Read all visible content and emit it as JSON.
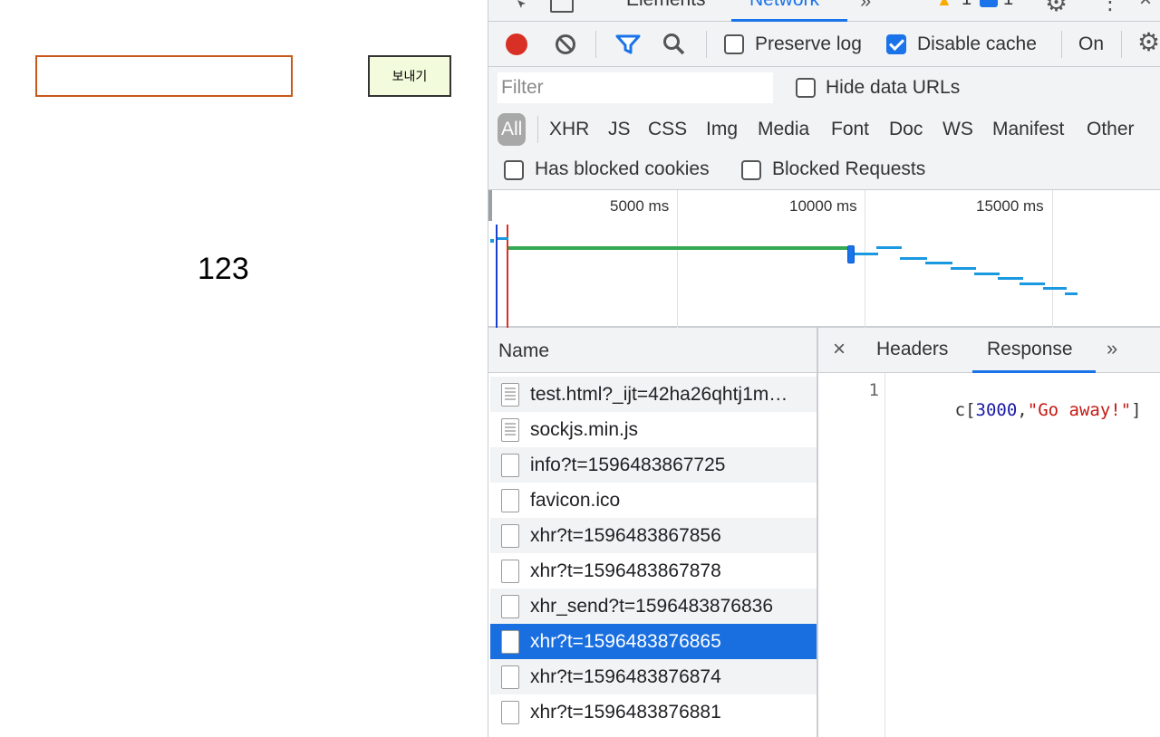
{
  "page": {
    "input_value": "",
    "send_label": "보내기",
    "value_text": "123"
  },
  "devtools": {
    "tabs": [
      "Elements",
      "Network"
    ],
    "badges": {
      "warnings": "1",
      "messages": "1"
    },
    "toolbar": {
      "preserve_log": {
        "label": "Preserve log",
        "checked": false
      },
      "disable_cache": {
        "label": "Disable cache",
        "checked": true
      },
      "throttle": "On"
    },
    "filter": {
      "placeholder": "Filter",
      "hide_data_urls": {
        "label": "Hide data URLs",
        "checked": false
      },
      "types": [
        "All",
        "XHR",
        "JS",
        "CSS",
        "Img",
        "Media",
        "Font",
        "Doc",
        "WS",
        "Manifest",
        "Other"
      ],
      "active_type": "All",
      "has_blocked_cookies": {
        "label": "Has blocked cookies",
        "checked": false
      },
      "blocked_requests": {
        "label": "Blocked Requests",
        "checked": false
      }
    },
    "overview": {
      "ticks": [
        "5000 ms",
        "10000 ms",
        "15000 ms"
      ]
    },
    "requests": {
      "column": "Name",
      "rows": [
        {
          "name": "test.html?_ijt=42ha26qhtj1m…",
          "icon": "document-icon"
        },
        {
          "name": "sockjs.min.js",
          "icon": "document-icon"
        },
        {
          "name": "info?t=1596483867725",
          "icon": "blank-file-icon"
        },
        {
          "name": "favicon.ico",
          "icon": "blank-file-icon"
        },
        {
          "name": "xhr?t=1596483867856",
          "icon": "blank-file-icon"
        },
        {
          "name": "xhr?t=1596483867878",
          "icon": "blank-file-icon"
        },
        {
          "name": "xhr_send?t=1596483876836",
          "icon": "blank-file-icon"
        },
        {
          "name": "xhr?t=1596483876865",
          "icon": "blank-file-icon"
        },
        {
          "name": "xhr?t=1596483876874",
          "icon": "blank-file-icon"
        },
        {
          "name": "xhr?t=1596483876881",
          "icon": "blank-file-icon"
        }
      ],
      "selected": "xhr?t=1596483876865"
    },
    "detail": {
      "tabs": [
        "Headers",
        "Response"
      ],
      "active_tab": "Response",
      "line_number": "1",
      "response": {
        "prefix": "c[",
        "number": "3000",
        "comma": ",",
        "string": "\"Go away!\"",
        "suffix": "]"
      }
    }
  }
}
